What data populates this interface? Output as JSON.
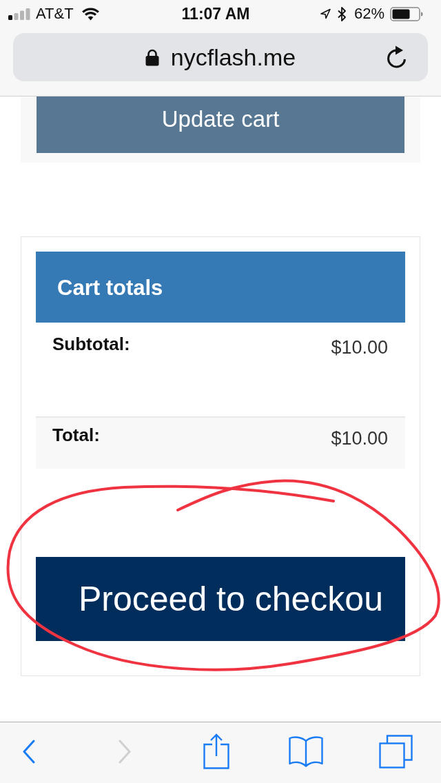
{
  "status_bar": {
    "carrier": "AT&T",
    "time": "11:07 AM",
    "battery": "62%"
  },
  "address_bar": {
    "url": "nycflash.me"
  },
  "cart_actions": {
    "update_button": "Update cart"
  },
  "cart_totals": {
    "title": "Cart totals",
    "rows": [
      {
        "kind": "subtotal",
        "label": "Subtotal:",
        "value": "$10.00"
      },
      {
        "kind": "total",
        "label": "Total:",
        "value": "$10.00"
      }
    ],
    "checkout_button": "Proceed to checkou"
  },
  "toolbar": {
    "items": [
      {
        "kind": "back",
        "disabled": false
      },
      {
        "kind": "forward",
        "disabled": true
      },
      {
        "kind": "share",
        "disabled": false
      },
      {
        "kind": "bookmarks",
        "disabled": false
      },
      {
        "kind": "tabs",
        "disabled": false
      }
    ]
  }
}
